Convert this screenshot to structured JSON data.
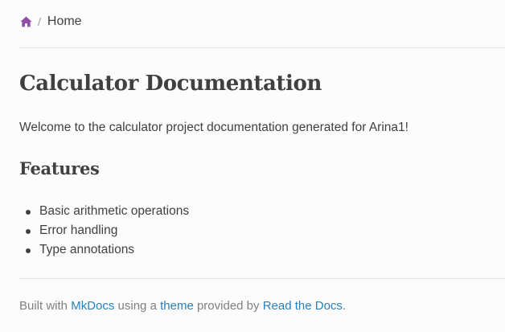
{
  "breadcrumb": {
    "home_icon": "home-icon",
    "separator": "/",
    "current": "Home"
  },
  "page": {
    "title": "Calculator Documentation",
    "intro": "Welcome to the calculator project documentation generated for Arina1!",
    "features_heading": "Features",
    "features": [
      "Basic arithmetic operations",
      "Error handling",
      "Type annotations"
    ]
  },
  "footer": {
    "built_with": "Built with ",
    "mkdocs_link": "MkDocs",
    "using_a": " using a ",
    "theme_link": "theme",
    "provided_by": " provided by ",
    "rtd_link": "Read the Docs",
    "period": "."
  },
  "colors": {
    "home_icon": "#8f4fa8",
    "link": "#2980b9",
    "text": "#404040",
    "muted": "#808080",
    "rule": "#e1e4e5",
    "background": "#fcfcfc"
  }
}
